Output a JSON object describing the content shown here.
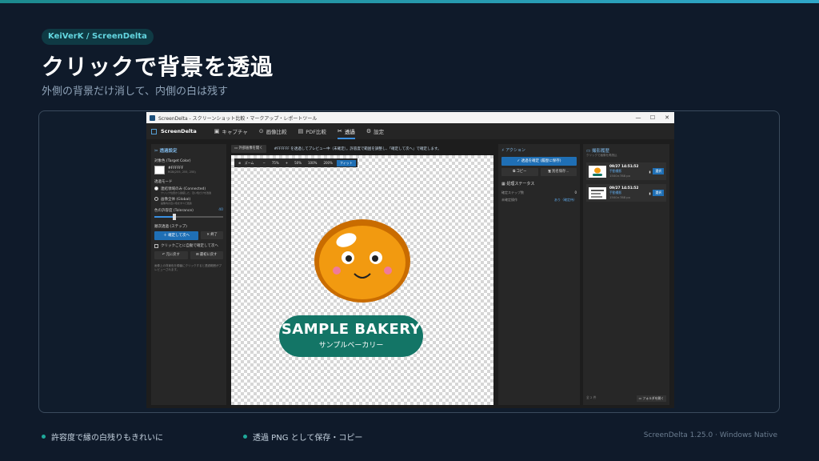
{
  "slide": {
    "badge": "KeiVerK / ScreenDelta",
    "title": "クリックで背景を透過",
    "subtitle": "外側の背景だけ消して、内側の白は残す",
    "bullets": [
      "許容度で縁の白残りもきれいに",
      "透過 PNG として保存・コピー"
    ],
    "footer": "ScreenDelta 1.25.0 · Windows Native"
  },
  "window": {
    "title": "ScreenDelta - スクリーンショット比較・マークアップ・レポートツール",
    "controls": [
      "—",
      "☐",
      "✕"
    ]
  },
  "nav": {
    "brand": "ScreenDelta",
    "tabs": [
      {
        "icon": "▣",
        "label": "キャプチャ"
      },
      {
        "icon": "⊙",
        "label": "画像比較"
      },
      {
        "icon": "▤",
        "label": "PDF比較"
      },
      {
        "icon": "✂",
        "label": "透過",
        "active": true
      },
      {
        "icon": "⚙",
        "label": "設定"
      }
    ]
  },
  "left": {
    "heading": "透過設定",
    "target_label": "対象色 (Target Color)",
    "target_hex": "#FFFFFF",
    "target_rgb": "RGB(255, 255, 255)",
    "mode_label": "透過モード",
    "modes": [
      {
        "label": "連結領域のみ (Connected)",
        "desc": "クリック位置から連結した、近い色だけを透過",
        "on": true
      },
      {
        "label": "画像全体 (Global)",
        "desc": "画像内の近い色をすべて透過",
        "on": false
      }
    ],
    "tolerance_label": "色の許容度 (Tolerance)",
    "tolerance_value": "40",
    "steps_label": "順次透過 (ステップ)",
    "confirm_next": "確定して次へ",
    "finish": "✕ 終了",
    "auto_check": "クリックごとに自動で確定して次へ",
    "undo": "↶ 元に戻す",
    "reset": "⊞ 最初に戻す",
    "note": "画像上の背景色を順番にクリックすると透過範囲がプレビューされます。"
  },
  "center": {
    "open_btn": "外部画像を開く",
    "message": "#FFFFFF を透過してプレビュー中（未確定）。許容度で範囲を調整し、「確定して次へ」で確定します。",
    "zoom": {
      "label": "ズーム",
      "minus": "−",
      "value": "75%",
      "plus": "+",
      "p50": "50%",
      "p100": "100%",
      "p200": "200%",
      "fit": "フィット"
    },
    "art": {
      "line1": "SAMPLE BAKERY",
      "line2": "サンプルベーカリー"
    }
  },
  "right": {
    "action_heading": "アクション",
    "save_btn": "透過を確定 (履歴に保存)",
    "copy_btn": "コピー",
    "save_as_btn": "別名保存...",
    "status_heading": "処理ステータス",
    "status": [
      {
        "k": "確定ステップ数",
        "v": "0"
      },
      {
        "k": "未確定操作",
        "v": "あり（確定待）"
      }
    ]
  },
  "history": {
    "heading": "撮影履歴",
    "sub": "クリックで画像を再読込",
    "items": [
      {
        "time": "09/27 14:51:52",
        "type": "手動撮影",
        "size": "1500×788 px",
        "select": "選択"
      },
      {
        "time": "09/27 14:51:52",
        "type": "手動撮影",
        "size": "1500×788 px",
        "select": "選択"
      }
    ],
    "count": "全 2 件",
    "open_folder": "フォルダを開く"
  }
}
